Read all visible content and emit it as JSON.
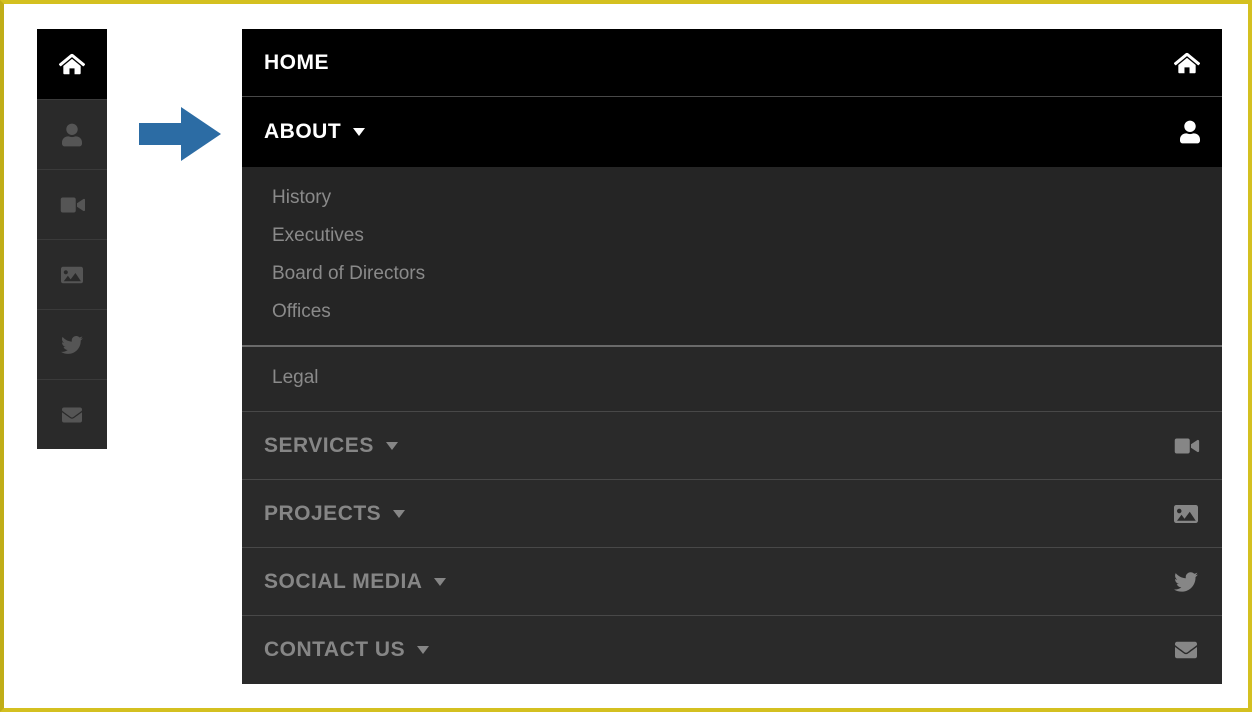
{
  "rail": [
    {
      "name": "home-icon",
      "icon": "home",
      "active": true
    },
    {
      "name": "user-icon",
      "icon": "user",
      "active": false
    },
    {
      "name": "video-icon",
      "icon": "video",
      "active": false
    },
    {
      "name": "image-icon",
      "icon": "image",
      "active": false
    },
    {
      "name": "twitter-icon",
      "icon": "twitter",
      "active": false
    },
    {
      "name": "mail-icon",
      "icon": "mail",
      "active": false
    }
  ],
  "menu": {
    "home": {
      "label": "HOME",
      "icon": "home"
    },
    "about": {
      "label": "ABOUT",
      "icon": "user"
    },
    "about_sub1": [
      {
        "label": "History"
      },
      {
        "label": "Executives"
      },
      {
        "label": "Board of Directors"
      },
      {
        "label": "Offices"
      }
    ],
    "about_sub2": [
      {
        "label": "Legal"
      }
    ],
    "services": {
      "label": "SERVICES",
      "icon": "video"
    },
    "projects": {
      "label": "PROJECTS",
      "icon": "image"
    },
    "social": {
      "label": "SOCIAL MEDIA",
      "icon": "twitter"
    },
    "contact": {
      "label": "CONTACT US",
      "icon": "mail"
    }
  },
  "colors": {
    "arrow": "#2c6ca4"
  }
}
